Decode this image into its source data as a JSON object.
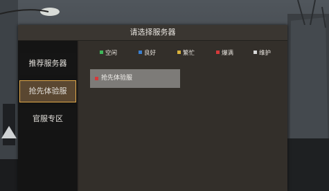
{
  "dialog": {
    "title": "请选择服务器"
  },
  "sidebar": {
    "items": [
      {
        "label": "推荐服务器",
        "active": false
      },
      {
        "label": "抢先体验服",
        "active": true
      },
      {
        "label": "官服专区",
        "active": false
      }
    ]
  },
  "legend": {
    "items": [
      {
        "label": "空闲",
        "color": "#3fb65a"
      },
      {
        "label": "良好",
        "color": "#3a7fd0"
      },
      {
        "label": "繁忙",
        "color": "#d9b13b"
      },
      {
        "label": "爆满",
        "color": "#d6393a"
      },
      {
        "label": "维护",
        "color": "#d8d8d8"
      }
    ]
  },
  "servers": [
    {
      "name": "抢先体验服",
      "status_color": "#d6393a"
    }
  ],
  "colors": {
    "accent_border": "#e2a94a",
    "active_tab_bg": "#5a4731"
  }
}
